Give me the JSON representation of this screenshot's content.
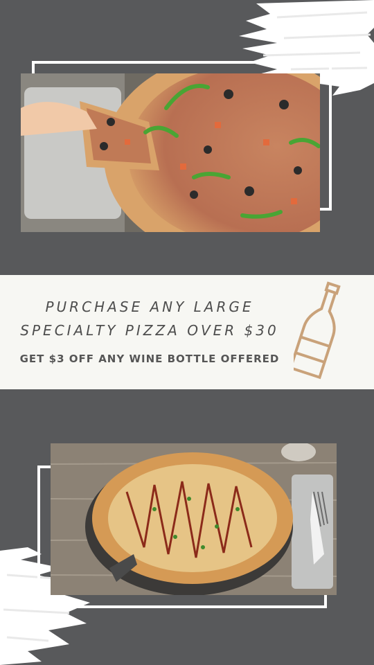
{
  "promo": {
    "headline_line1": "PURCHASE ANY LARGE",
    "headline_line2": "SPECIALTY PIZZA OVER $30",
    "offer": "GET $3 OFF ANY WINE BOTTLE OFFERED"
  },
  "colors": {
    "background": "#58595b",
    "band": "#f7f7f3",
    "icon": "#c9a27a",
    "frame": "#ffffff"
  },
  "icons": [
    "wine-bottle-icon"
  ]
}
